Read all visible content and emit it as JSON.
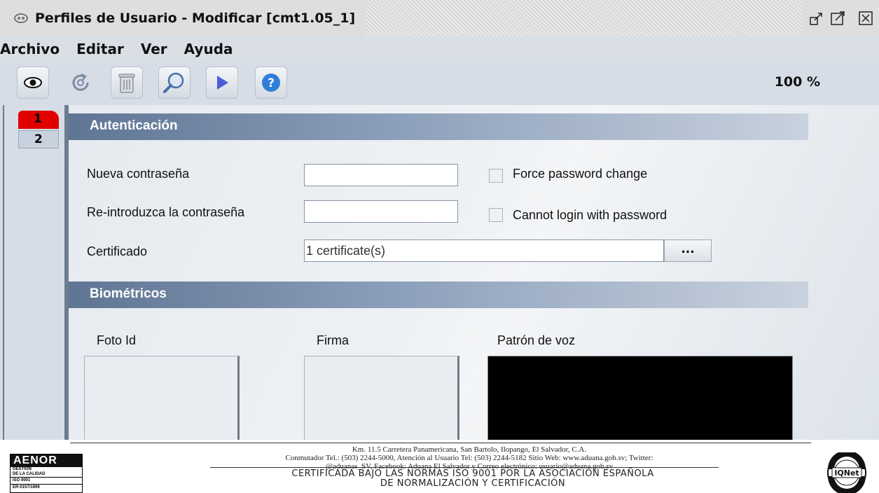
{
  "window": {
    "title": "Perfiles de Usuario - Modificar [cmt1.05_1]"
  },
  "menu": [
    "Archivo",
    "Editar",
    "Ver",
    "Ayuda"
  ],
  "toolbar": {
    "buttons": [
      "eye-icon",
      "refresh-icon",
      "trash-icon",
      "search-icon",
      "play-icon",
      "help-icon"
    ],
    "zoom": "100 %"
  },
  "tabs": [
    "1",
    "2"
  ],
  "autenticacion": {
    "title": "Autenticación",
    "new_password_label": "Nueva contraseña",
    "new_password_value": "",
    "reenter_password_label": "Re-introduzca la contraseña",
    "reenter_password_value": "",
    "force_change_label": "Force password change",
    "cannot_login_label": "Cannot login with password",
    "certificate_label": "Certificado",
    "certificate_value": "1 certificate(s)",
    "browse_label": "..."
  },
  "biometricos": {
    "title": "Biométricos",
    "photo_label": "Foto Id",
    "signature_label": "Firma",
    "voice_label": "Patrón de voz"
  },
  "footer": {
    "address_line1": "Km. 11.5 Carretera Panamericana, San Bartolo, Ilopango, El Salvador, C.A.",
    "address_line2": "Conmutador Tel.: (503) 2244-5000, Atención al Usuario Tel: (503) 2244-5182 Sitio Web: www.aduana.gob.sv; Twitter:",
    "address_line3": "@aduanas_SV, Facebook: Aduana El Salvador y Correo electrónico: usuario@aduana.gob.sv",
    "cert_line1": "CERTIFICADA BAJO LAS NORMAS ISO 9001 POR LA ASOCIACIÓN ESPAÑOLA",
    "cert_line2": "DE NORMALIZACIÓN Y CERTIFICACIÓN",
    "aenor_logo": "AENOR",
    "aenor_sub1": "GESTIÓN",
    "aenor_sub2": "DE LA CALIDAD",
    "aenor_std": "ISO 9001",
    "aenor_reg": "ER-0157/1999",
    "iqnet_logo": "IQNet",
    "iqnet_ring_top": "CERTIFIED",
    "iqnet_ring_bottom": "MANAGEMENT SYSTEM"
  }
}
